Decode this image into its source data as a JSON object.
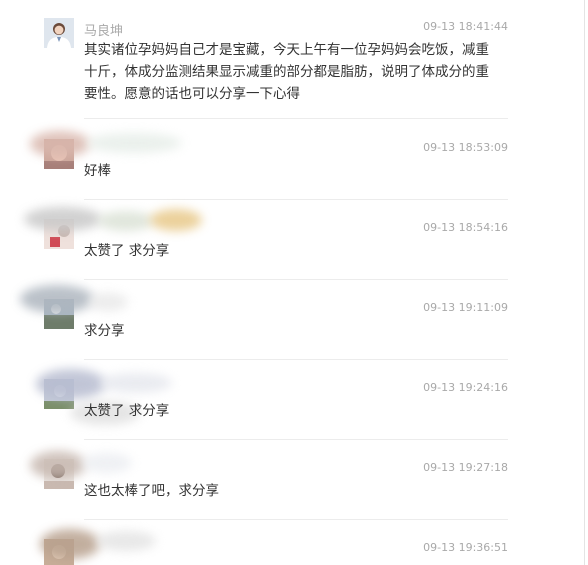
{
  "comments": [
    {
      "name": "马良坤",
      "time": "09-13 18:41:44",
      "text": "其实诸位孕妈妈自己才是宝藏，今天上午有一位孕妈妈会吃饭，减重十斤，体成分监测结果显示减重的部分都是脂肪，说明了体成分的重要性。愿意的话也可以分享一下心得"
    },
    {
      "time": "09-13 18:53:09",
      "text": "好棒"
    },
    {
      "time": "09-13 18:54:16",
      "text": "太赞了  求分享"
    },
    {
      "time": "09-13 19:11:09",
      "text": "求分享"
    },
    {
      "time": "09-13 19:24:16",
      "text": "太赞了  求分享"
    },
    {
      "time": "09-13 19:27:18",
      "text": "这也太棒了吧，求分享"
    },
    {
      "time": "09-13 19:36:51"
    }
  ]
}
